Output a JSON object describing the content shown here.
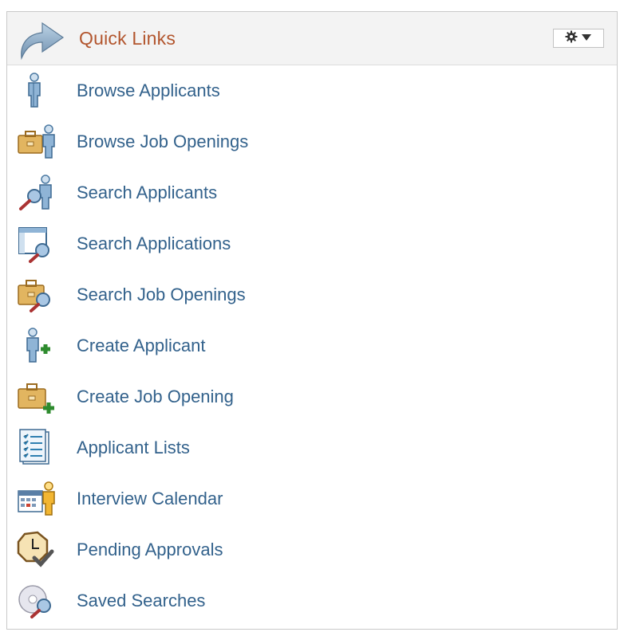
{
  "header": {
    "title": "Quick Links",
    "icon": "curved-arrow-icon",
    "menu_icons": [
      "gear-icon",
      "caret-down-icon"
    ]
  },
  "items": [
    {
      "label": "Browse Applicants",
      "icon": "person-icon"
    },
    {
      "label": "Browse Job Openings",
      "icon": "briefcase-person-icon"
    },
    {
      "label": "Search Applicants",
      "icon": "person-magnifier-icon"
    },
    {
      "label": "Search Applications",
      "icon": "window-magnifier-icon"
    },
    {
      "label": "Search Job Openings",
      "icon": "briefcase-magnifier-icon"
    },
    {
      "label": "Create Applicant",
      "icon": "person-plus-icon"
    },
    {
      "label": "Create Job Opening",
      "icon": "briefcase-plus-icon"
    },
    {
      "label": "Applicant Lists",
      "icon": "checklist-icon"
    },
    {
      "label": "Interview Calendar",
      "icon": "calendar-person-icon"
    },
    {
      "label": "Pending Approvals",
      "icon": "clock-check-icon"
    },
    {
      "label": "Saved Searches",
      "icon": "disc-magnifier-icon"
    }
  ],
  "colors": {
    "title": "#b2552d",
    "link": "#33628c",
    "header_bg": "#f3f3f3",
    "border": "#c9c9c9"
  }
}
